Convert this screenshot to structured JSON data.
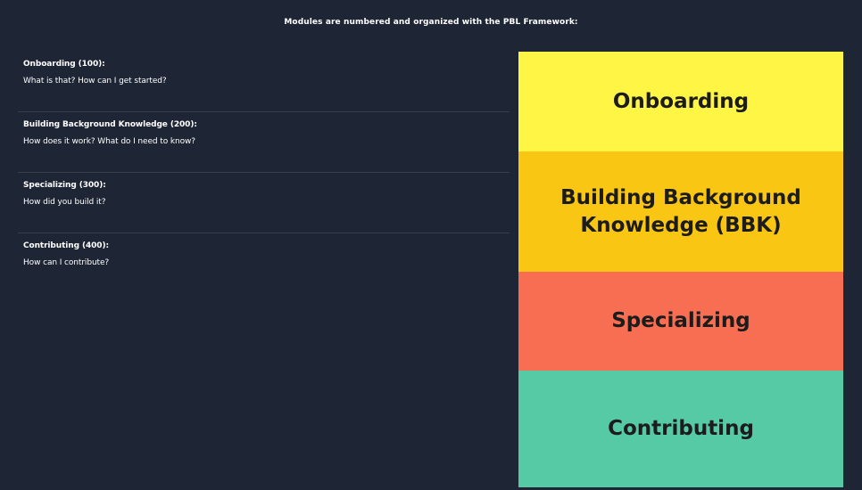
{
  "header": {
    "title": "Modules are numbered and organized with the PBL Framework:"
  },
  "modules": [
    {
      "title": "Onboarding (100):",
      "question": "What is that? How can I get started?"
    },
    {
      "title": "Building Background Knowledge (200):",
      "question": "How does it work? What do I need to know?"
    },
    {
      "title": "Specializing (300):",
      "question": "How did you build it?"
    },
    {
      "title": "Contributing (400):",
      "question": "How can I contribute?"
    }
  ],
  "framework": {
    "tiers": [
      {
        "label": "Onboarding",
        "color": "#fff544"
      },
      {
        "label": "Building Background Knowledge (BBK)",
        "color": "#fac614"
      },
      {
        "label": "Specializing",
        "color": "#f76e52"
      },
      {
        "label": "Contributing",
        "color": "#56c9a5"
      }
    ]
  },
  "colors": {
    "background": "#1e2535",
    "divider": "#353d4e",
    "text": "#ffffff",
    "tier_text": "#1c1c1c"
  }
}
